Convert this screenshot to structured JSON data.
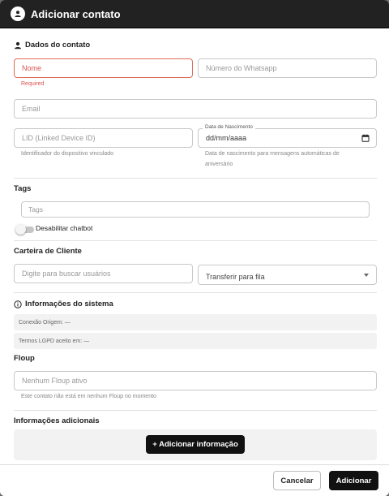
{
  "dialog": {
    "title": "Adicionar contato",
    "icon": "person-icon"
  },
  "sections": {
    "contact": "Dados do contato",
    "tags": "Tags",
    "wallet": "Carteira de Cliente",
    "system": "Informações do sistema",
    "floup": "Floup",
    "extra": "Informações adicionais"
  },
  "fields": {
    "name_placeholder": "Nome",
    "name_error": "Required",
    "whatsapp_placeholder": "Número do Whatsapp",
    "email_placeholder": "Email",
    "lid_placeholder": "LID (Linked Device ID)",
    "lid_helper": "Identificador do dispositivo vinculado",
    "birth_label": "Data de Nascimento",
    "birth_value": "dd/mm/aaaa",
    "birth_helper_line1": "Data de nascimento para mensagens automáticas de",
    "birth_helper_line2": "aniversário",
    "tags_placeholder": "Tags",
    "disable_chatbot": "Desabilitar chatbot",
    "disable_chatbot_on": false,
    "search_users_placeholder": "Digite para buscar usuários",
    "transfer_queue": "Transferir para fila",
    "floup_placeholder": "Nenhum Floup ativo",
    "floup_helper": "Este contato não está em nenhum Floup no momento"
  },
  "system_info": {
    "origin": "Conexão Origem: —",
    "lgpd": "Termos LGPD aceito em: —"
  },
  "buttons": {
    "add_info": "+ Adicionar informação",
    "cancel": "Cancelar",
    "add": "Adicionar"
  },
  "colors": {
    "header_bg": "#222222",
    "primary": "#111111",
    "error": "#d9534f"
  }
}
